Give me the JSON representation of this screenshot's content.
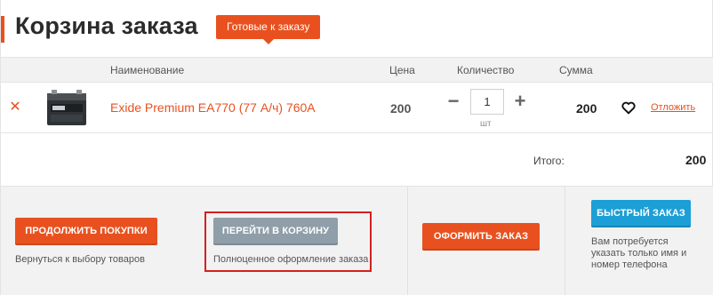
{
  "header": {
    "title": "Корзина заказа",
    "ready_badge": "Готовые к заказу"
  },
  "table": {
    "columns": {
      "name": "Наименование",
      "price": "Цена",
      "quantity": "Количество",
      "sum": "Сумма"
    },
    "items": [
      {
        "name": "Exide Premium EA770 (77 А/ч) 760А",
        "price": "200",
        "quantity": "1",
        "unit": "шт",
        "sum": "200",
        "postpone_label": "Отложить",
        "remove_icon": "close-x-icon",
        "image_icon": "car-battery-icon",
        "favorite_icon": "heart-icon"
      }
    ]
  },
  "totals": {
    "label": "Итого:",
    "value": "200"
  },
  "footer": {
    "continue_label": "Продолжить покупки",
    "continue_note": "Вернуться к выбору товаров",
    "goto_cart_label": "Перейти в корзину",
    "goto_cart_note": "Полноценное оформление заказа",
    "checkout_label": "Оформить заказ",
    "quick_order_label": "Быстрый заказ",
    "quick_order_note": "Вам потребуется указать только имя и номер телефона"
  },
  "colors": {
    "accent": "#e8511f",
    "gray_button": "#8f9ea8",
    "blue_button": "#1b9fd6",
    "highlight_border": "#d51f1f"
  }
}
